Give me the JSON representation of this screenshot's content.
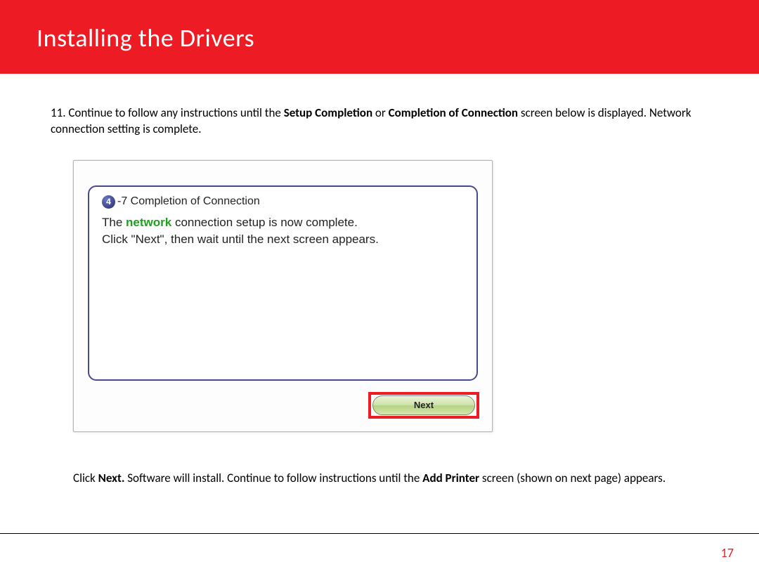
{
  "header": {
    "title": "Installing  the Drivers"
  },
  "step": {
    "prefix": "11. Continue to follow any instructions until the ",
    "bold1": "Setup Completion",
    "mid1": " or ",
    "bold2": "Completion of Connection",
    "suffix": " screen below is displayed. Network connection setting is complete."
  },
  "dialog": {
    "badge_number": "4",
    "badge_text": "-7 Completion of Connection",
    "line1_pre": "The ",
    "line1_kw": "network",
    "line1_post": " connection setup is now complete.",
    "line2": "Click \"Next\", then wait until the next screen appears.",
    "next_label": "Next"
  },
  "after": {
    "pre1": "Click ",
    "bold1": "Next.",
    "mid1": "  Software will install.  Continue to follow instructions until the ",
    "bold2": "Add Printer",
    "post": " screen (shown on next page) appears."
  },
  "page_number": "17"
}
